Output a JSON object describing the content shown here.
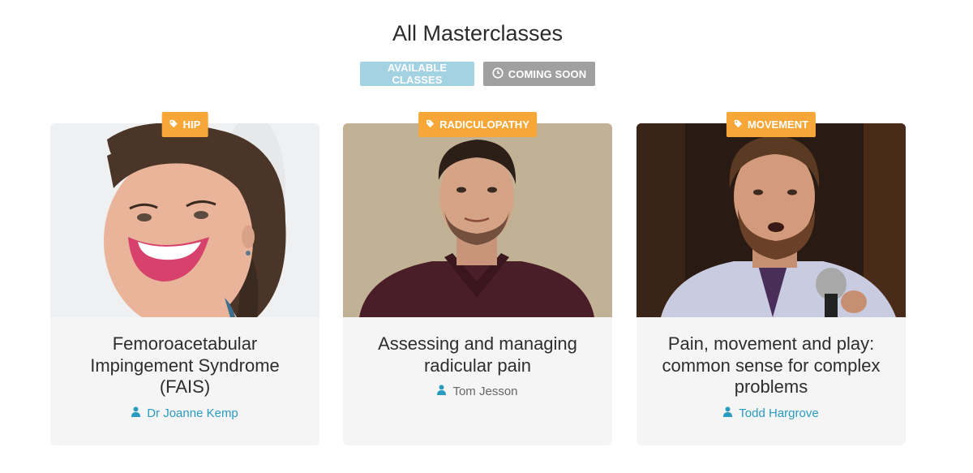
{
  "page": {
    "title": "All Masterclasses"
  },
  "filters": {
    "available_label": "AVAILABLE CLASSES",
    "coming_soon_label": "COMING SOON"
  },
  "cards": [
    {
      "tag": "HIP",
      "title": "Femoroacetabular Impingement Syndrome (FAIS)",
      "author": "Dr Joanne Kemp"
    },
    {
      "tag": "RADICULOPATHY",
      "title": "Assessing and managing radicular pain",
      "author": "Tom Jesson"
    },
    {
      "tag": "MOVEMENT",
      "title": "Pain, movement and play: common sense for complex problems",
      "author": "Todd Hargrove"
    }
  ],
  "colors": {
    "available_button": "#a3d2e3",
    "coming_soon_button": "#a0a0a0",
    "tag": "#f7a738",
    "author_link": "#2a9bc0",
    "card_background": "#f5f5f5"
  },
  "icons": {
    "tag": "tag-icon",
    "clock": "clock-icon",
    "user": "user-icon"
  }
}
